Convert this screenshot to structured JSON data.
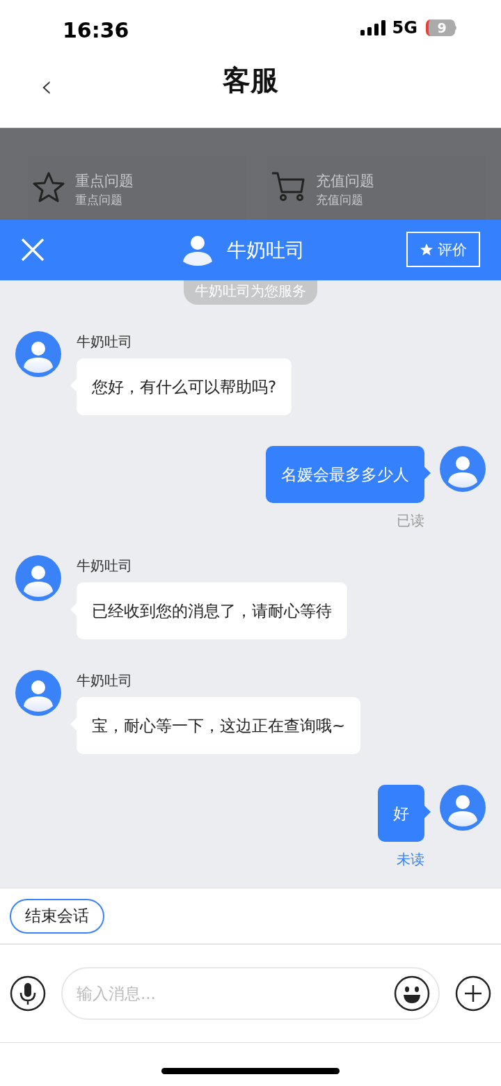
{
  "status_bar": {
    "time": "16:36",
    "network": "5G",
    "battery": "9"
  },
  "header": {
    "back": "‹",
    "title": "客服"
  },
  "quick_topics": [
    {
      "kind": "star",
      "title": "重点问题",
      "subtitle": "重点问题"
    },
    {
      "kind": "cart",
      "title": "充值问题",
      "subtitle": "充值问题"
    }
  ],
  "chat_bar": {
    "agent": "牛奶吐司",
    "rate_button": "评价"
  },
  "service_notice": "牛奶吐司为您服务",
  "messages": [
    {
      "kind": "agent",
      "name": "牛奶吐司",
      "text": "您好，有什么可以帮助吗?"
    },
    {
      "kind": "user",
      "text": "名媛会最多多少人",
      "status": "已读",
      "read": true
    },
    {
      "kind": "agent",
      "name": "牛奶吐司",
      "text": "已经收到您的消息了，请耐心等待"
    },
    {
      "kind": "agent",
      "name": "牛奶吐司",
      "text": "宝，耐心等一下，这边正在查询哦~"
    },
    {
      "kind": "user",
      "text": "好",
      "status": "未读",
      "read": false
    }
  ],
  "quick_actions": [
    "结束会话"
  ],
  "input": {
    "placeholder": "输入消息..."
  }
}
